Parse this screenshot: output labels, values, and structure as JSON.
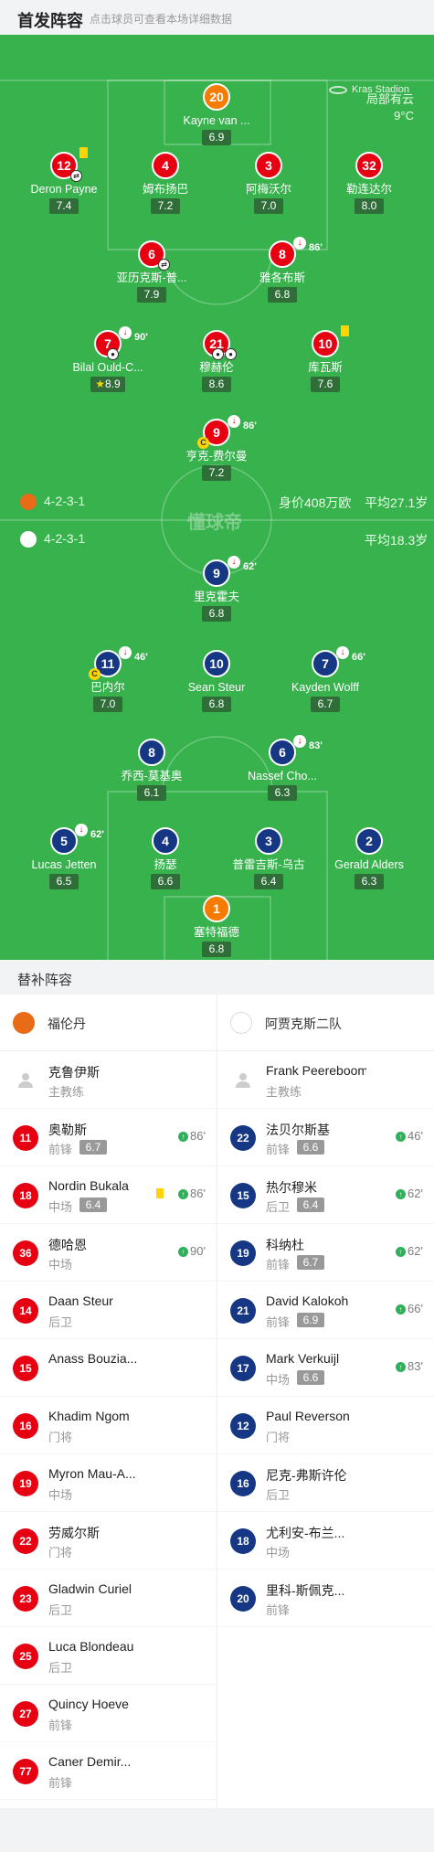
{
  "header": {
    "title": "首发阵容",
    "subtitle": "点击球员可查看本场详细数据"
  },
  "venue": {
    "stadium": "Kras Stadion",
    "weather": "局部有云",
    "temperature": "9°C"
  },
  "watermark": "懂球帝",
  "home_team": {
    "name": "福伦丹",
    "formation": "4-2-3-1",
    "value": "身价408万欧",
    "avg_age": "平均27.1岁",
    "color": "#e60012"
  },
  "away_team": {
    "name": "阿贾克斯二队",
    "formation": "4-2-3-1",
    "avg_age": "平均18.3岁",
    "color": "#163783"
  },
  "home_players": [
    {
      "num": "20",
      "name": "Kayne van ...",
      "rating": "6.9"
    },
    {
      "num": "12",
      "name": "Deron Payne",
      "rating": "7.4"
    },
    {
      "num": "4",
      "name": "姆布扬巴",
      "rating": "7.2"
    },
    {
      "num": "3",
      "name": "阿梅沃尔",
      "rating": "7.0"
    },
    {
      "num": "32",
      "name": "勒连达尔",
      "rating": "8.0"
    },
    {
      "num": "6",
      "name": "亚历克斯-普...",
      "rating": "7.9"
    },
    {
      "num": "8",
      "name": "雅各布斯",
      "rating": "6.8",
      "sub": "86'"
    },
    {
      "num": "7",
      "name": "Bilal Ould-C...",
      "rating": "8.9",
      "sub": "90'"
    },
    {
      "num": "21",
      "name": "穆赫伦",
      "rating": "8.6"
    },
    {
      "num": "10",
      "name": "库瓦斯",
      "rating": "7.6"
    },
    {
      "num": "9",
      "name": "亨克-费尔曼",
      "rating": "7.2",
      "sub": "86'"
    }
  ],
  "away_players": [
    {
      "num": "9",
      "name": "里克霍夫",
      "rating": "6.8",
      "sub": "62'"
    },
    {
      "num": "11",
      "name": "巴内尔",
      "rating": "7.0",
      "sub": "46'"
    },
    {
      "num": "10",
      "name": "Sean Steur",
      "rating": "6.8"
    },
    {
      "num": "7",
      "name": "Kayden Wolff",
      "rating": "6.7",
      "sub": "66'"
    },
    {
      "num": "8",
      "name": "乔西-莫基奥",
      "rating": "6.1"
    },
    {
      "num": "6",
      "name": "Nassef Cho...",
      "rating": "6.3",
      "sub": "83'"
    },
    {
      "num": "5",
      "name": "Lucas Jetten",
      "rating": "6.5",
      "sub": "62'"
    },
    {
      "num": "4",
      "name": "扬瑟",
      "rating": "6.6"
    },
    {
      "num": "3",
      "name": "普雷吉斯-乌古",
      "rating": "6.4"
    },
    {
      "num": "2",
      "name": "Gerald Alders",
      "rating": "6.3"
    },
    {
      "num": "1",
      "name": "塞特福德",
      "rating": "6.8"
    }
  ],
  "subs_header": "替补阵容",
  "home_subs": {
    "coach": {
      "name": "克鲁伊斯",
      "role": "主教练"
    },
    "players": [
      {
        "num": "11",
        "name": "奥勒斯",
        "pos": "前锋",
        "rating": "6.7",
        "in": "86'"
      },
      {
        "num": "18",
        "name": "Nordin Bukala",
        "pos": "中场",
        "rating": "6.4",
        "in": "86'"
      },
      {
        "num": "36",
        "name": "德哈恩",
        "pos": "中场",
        "in": "90'"
      },
      {
        "num": "14",
        "name": "Daan Steur",
        "pos": "后卫"
      },
      {
        "num": "15",
        "name": "Anass Bouzia...",
        "pos": ""
      },
      {
        "num": "16",
        "name": "Khadim Ngom",
        "pos": "门将"
      },
      {
        "num": "19",
        "name": "Myron Mau-A...",
        "pos": "中场"
      },
      {
        "num": "22",
        "name": "劳威尔斯",
        "pos": "门将"
      },
      {
        "num": "23",
        "name": "Gladwin Curiel",
        "pos": "后卫"
      },
      {
        "num": "25",
        "name": "Luca Blondeau",
        "pos": "后卫"
      },
      {
        "num": "27",
        "name": "Quincy Hoeve",
        "pos": "前锋"
      },
      {
        "num": "77",
        "name": "Caner Demir...",
        "pos": "前锋"
      }
    ]
  },
  "away_subs": {
    "coach": {
      "name": "Frank Peereboom",
      "role": "主教练"
    },
    "players": [
      {
        "num": "22",
        "name": "法贝尔斯基",
        "pos": "前锋",
        "rating": "6.6",
        "in": "46'"
      },
      {
        "num": "15",
        "name": "热尔穆米",
        "pos": "后卫",
        "rating": "6.4",
        "in": "62'"
      },
      {
        "num": "19",
        "name": "科纳杜",
        "pos": "前锋",
        "rating": "6.7",
        "in": "62'"
      },
      {
        "num": "21",
        "name": "David Kalokoh",
        "pos": "前锋",
        "rating": "6.9",
        "in": "66'"
      },
      {
        "num": "17",
        "name": "Mark Verkuijl",
        "pos": "中场",
        "rating": "6.6",
        "in": "83'"
      },
      {
        "num": "12",
        "name": "Paul Reverson",
        "pos": "门将"
      },
      {
        "num": "16",
        "name": "尼克-弗斯许伦",
        "pos": "后卫"
      },
      {
        "num": "18",
        "name": "尤利安-布兰...",
        "pos": "中场"
      },
      {
        "num": "20",
        "name": "里科-斯佩克...",
        "pos": "前锋"
      }
    ]
  }
}
